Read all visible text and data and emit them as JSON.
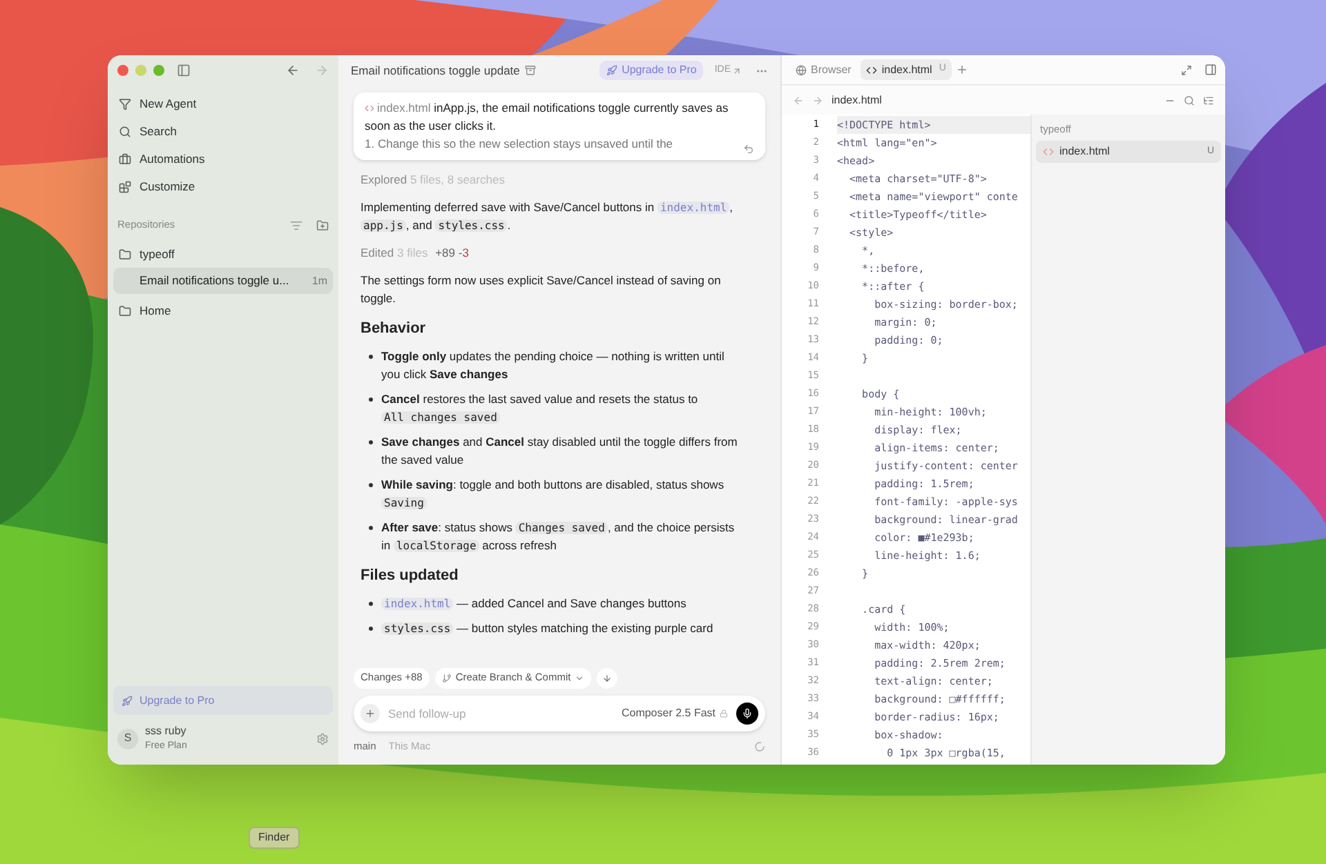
{
  "sidebar": {
    "nav": [
      {
        "label": "New Agent"
      },
      {
        "label": "Search"
      },
      {
        "label": "Automations"
      },
      {
        "label": "Customize"
      }
    ],
    "repositories_label": "Repositories",
    "tree": [
      {
        "label": "typeoff",
        "kind": "folder",
        "children": [
          {
            "label": "Email notifications toggle u...",
            "time": "1m",
            "selected": true
          }
        ]
      },
      {
        "label": "Home",
        "kind": "folder"
      }
    ],
    "upgrade": "Upgrade to Pro",
    "user": {
      "initial": "S",
      "name": "sss ruby",
      "plan": "Free Plan"
    }
  },
  "chat": {
    "title": "Email notifications toggle update",
    "upgrade": "Upgrade to Pro",
    "ide": "IDE",
    "prompt": {
      "file": "index.html",
      "text": "inApp.js, the email notifications toggle currently saves as soon as the user clicks it.",
      "next": "1. Change this so the new selection stays unsaved until the"
    },
    "blocks": [
      {
        "kind": "summary",
        "label": "Explored",
        "detail": "5 files, 8 searches"
      },
      {
        "kind": "paragraph",
        "segments": [
          {
            "kind": "text",
            "text": "Implementing deferred save with Save/Cancel buttons in "
          },
          {
            "kind": "link",
            "text": "index.html"
          },
          {
            "kind": "text",
            "text": ", "
          },
          {
            "kind": "code",
            "text": "app.js"
          },
          {
            "kind": "text",
            "text": ", and "
          },
          {
            "kind": "code",
            "text": "styles.css"
          },
          {
            "kind": "text",
            "text": "."
          }
        ]
      },
      {
        "kind": "edited",
        "label": "Edited",
        "detail": "3 files",
        "added": "+89",
        "removed": "-3"
      },
      {
        "kind": "paragraph",
        "segments": [
          {
            "kind": "text",
            "text": "The settings form now uses explicit Save/Cancel instead of saving on toggle."
          }
        ]
      },
      {
        "kind": "heading",
        "text": "Behavior"
      },
      {
        "kind": "bullets",
        "items": [
          {
            "segments": [
              {
                "kind": "text",
                "text": "**Toggle only** updates the pending choice — nothing is written until you click **Save changes**"
              }
            ]
          },
          {
            "segments": [
              {
                "kind": "text",
                "text": "**Cancel** restores the last saved value and resets the status to "
              },
              {
                "kind": "code",
                "text": "All changes saved"
              }
            ]
          },
          {
            "segments": [
              {
                "kind": "text",
                "text": "**Save changes** and **Cancel** stay disabled until the toggle differs from the saved value"
              }
            ]
          },
          {
            "segments": [
              {
                "kind": "text",
                "text": "**While saving**: toggle and both buttons are disabled, status shows "
              },
              {
                "kind": "code",
                "text": "Saving"
              }
            ]
          },
          {
            "segments": [
              {
                "kind": "text",
                "text": "**After save**: status shows "
              },
              {
                "kind": "code",
                "text": "Changes saved"
              },
              {
                "kind": "text",
                "text": ", and the choice persists in "
              },
              {
                "kind": "code",
                "text": "localStorage"
              },
              {
                "kind": "text",
                "text": " across refresh"
              }
            ]
          }
        ]
      },
      {
        "kind": "heading",
        "text": "Files updated"
      },
      {
        "kind": "bullets",
        "items": [
          {
            "segments": [
              {
                "kind": "link",
                "text": "index.html"
              },
              {
                "kind": "text",
                "text": " — added Cancel and Save changes buttons"
              }
            ]
          },
          {
            "segments": [
              {
                "kind": "code",
                "text": "styles.css"
              },
              {
                "kind": "text",
                "text": " — button styles matching the existing purple card"
              }
            ]
          }
        ]
      }
    ],
    "changes": "Changes +88",
    "commit": "Create Branch & Commit",
    "input": {
      "placeholder": "Send follow-up"
    },
    "model": "Composer 2.5 Fast",
    "branch": "main",
    "location": "This Mac"
  },
  "editor": {
    "tabs": [
      {
        "label": "Browser",
        "kind": "browser",
        "selected": false
      },
      {
        "label": "index.html",
        "kind": "file",
        "badge": "U",
        "selected": true
      }
    ],
    "path": "index.html",
    "lines": [
      {
        "n": "1",
        "text": "<!DOCTYPE html>",
        "selected": true
      },
      {
        "n": "2",
        "text": "<html lang=\"en\">",
        "selected": false
      },
      {
        "n": "3",
        "text": "<head>",
        "selected": false
      },
      {
        "n": "4",
        "text": "  <meta charset=\"UTF-8\">",
        "selected": false
      },
      {
        "n": "5",
        "text": "  <meta name=\"viewport\" conte",
        "selected": false
      },
      {
        "n": "6",
        "text": "  <title>Typeoff</title>",
        "selected": false
      },
      {
        "n": "7",
        "text": "  <style>",
        "selected": false
      },
      {
        "n": "8",
        "text": "    *,",
        "selected": false
      },
      {
        "n": "9",
        "text": "    *::before,",
        "selected": false
      },
      {
        "n": "10",
        "text": "    *::after {",
        "selected": false
      },
      {
        "n": "11",
        "text": "      box-sizing: border-box;",
        "selected": false
      },
      {
        "n": "12",
        "text": "      margin: 0;",
        "selected": false
      },
      {
        "n": "13",
        "text": "      padding: 0;",
        "selected": false
      },
      {
        "n": "14",
        "text": "    }",
        "selected": false
      },
      {
        "n": "15",
        "selected": false
      },
      {
        "n": "16",
        "text": "    body {",
        "selected": false
      },
      {
        "n": "17",
        "text": "      min-height: 100vh;",
        "selected": false
      },
      {
        "n": "18",
        "text": "      display: flex;",
        "selected": false
      },
      {
        "n": "19",
        "text": "      align-items: center;",
        "selected": false
      },
      {
        "n": "20",
        "text": "      justify-content: center",
        "selected": false
      },
      {
        "n": "21",
        "text": "      padding: 1.5rem;",
        "selected": false
      },
      {
        "n": "22",
        "text": "      font-family: -apple-sys",
        "selected": false
      },
      {
        "n": "23",
        "text": "      background: linear-grad",
        "selected": false
      },
      {
        "n": "24",
        "text": "      color: ■#1e293b;",
        "selected": false
      },
      {
        "n": "25",
        "text": "      line-height: 1.6;",
        "selected": false
      },
      {
        "n": "26",
        "text": "    }",
        "selected": false
      },
      {
        "n": "27",
        "selected": false
      },
      {
        "n": "28",
        "text": "    .card {",
        "selected": false
      },
      {
        "n": "29",
        "text": "      width: 100%;",
        "selected": false
      },
      {
        "n": "30",
        "text": "      max-width: 420px;",
        "selected": false
      },
      {
        "n": "31",
        "text": "      padding: 2.5rem 2rem;",
        "selected": false
      },
      {
        "n": "32",
        "text": "      text-align: center;",
        "selected": false
      },
      {
        "n": "33",
        "text": "      background: □#ffffff;",
        "selected": false
      },
      {
        "n": "34",
        "text": "      border-radius: 16px;",
        "selected": false
      },
      {
        "n": "35",
        "text": "      box-shadow:",
        "selected": false
      },
      {
        "n": "36",
        "text": "        0 1px 3px □rgba(15,",
        "selected": false
      }
    ],
    "tree": {
      "root": "typeoff",
      "files": [
        {
          "label": "index.html",
          "badge": "U",
          "selected": true
        }
      ]
    }
  },
  "dock_tooltip": "Finder"
}
